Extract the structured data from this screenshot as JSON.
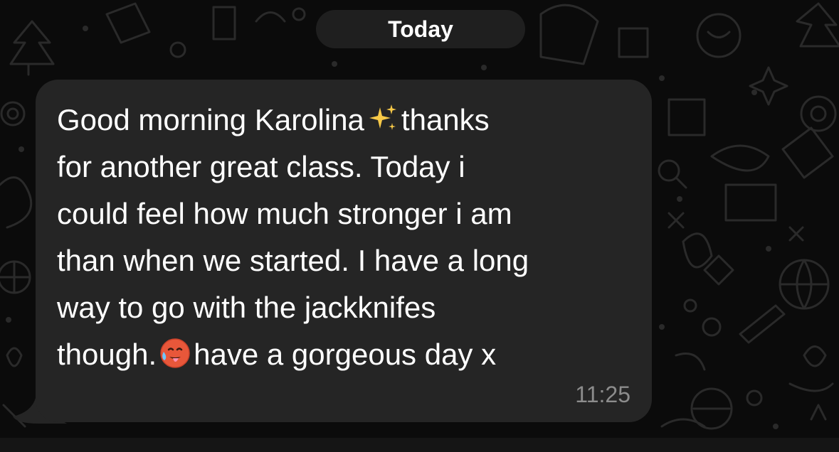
{
  "chat": {
    "date_separator": "Today",
    "message": {
      "segments": [
        "Good morning Karolina",
        "thanks\nfor another great class. Today i\ncould feel how much stronger i am\nthan when we started. I have a long\nway to go with the jackknifes\nthough.",
        "have a gorgeous day x"
      ],
      "emojis": [
        "sparkles",
        "hot-face"
      ],
      "time": "11:25"
    }
  },
  "colors": {
    "background": "#0b0b0b",
    "bubble": "#252525",
    "date_pill": "#1f1f1f",
    "text": "#ffffff",
    "timestamp": "#8c8c8c"
  }
}
